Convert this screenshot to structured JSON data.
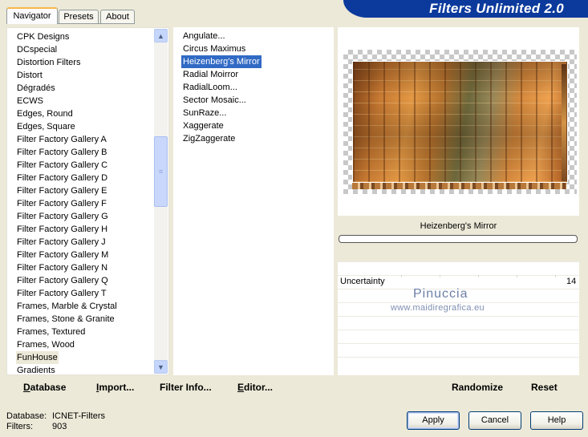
{
  "tabs": [
    {
      "label": "Navigator",
      "active": true
    },
    {
      "label": "Presets",
      "active": false
    },
    {
      "label": "About",
      "active": false
    }
  ],
  "banner": {
    "title": "Filters Unlimited 2.0",
    "color": "#0c3a9c"
  },
  "categories": [
    "CPK Designs",
    "DCspecial",
    "Distortion Filters",
    "Distort",
    "Dégradés",
    "ECWS",
    "Edges, Round",
    "Edges, Square",
    "Filter Factory Gallery A",
    "Filter Factory Gallery B",
    "Filter Factory Gallery C",
    "Filter Factory Gallery D",
    "Filter Factory Gallery E",
    "Filter Factory Gallery F",
    "Filter Factory Gallery G",
    "Filter Factory Gallery H",
    "Filter Factory Gallery J",
    "Filter Factory Gallery M",
    "Filter Factory Gallery N",
    "Filter Factory Gallery Q",
    "Filter Factory Gallery T",
    "Frames, Marble & Crystal",
    "Frames, Stone & Granite",
    "Frames, Textured",
    "Frames, Wood",
    "FunHouse",
    "Gradients"
  ],
  "selected_category": "FunHouse",
  "filters": [
    "Angulate...",
    "Circus Maximus",
    "Heizenberg's Mirror",
    "Radial Moirror",
    "RadialLoom...",
    "Sector Mosaic...",
    "SunRaze...",
    "Xaggerate",
    "ZigZaggerate"
  ],
  "selected_filter": "Heizenberg's Mirror",
  "selection_color": "#316ac5",
  "current_filter_name": "Heizenberg's Mirror",
  "parameters": [
    {
      "name": "Uncertainty",
      "value": "14"
    }
  ],
  "watermark": {
    "name": "Pinuccia",
    "url": "www.maidiregrafica.eu"
  },
  "toolbar_left": [
    {
      "label": "Database",
      "underline": "D",
      "rest": "atabase"
    },
    {
      "label": "Import...",
      "underline": "I",
      "rest": "mport..."
    },
    {
      "label": "Filter Info...",
      "underline": "",
      "rest": "Filter Info..."
    },
    {
      "label": "Editor...",
      "underline": "E",
      "rest": "ditor..."
    }
  ],
  "toolbar_right": [
    {
      "label": "Randomize"
    },
    {
      "label": "Reset"
    }
  ],
  "status": {
    "database_label": "Database:",
    "database_value": "ICNET-Filters",
    "filters_label": "Filters:",
    "filters_value": "903"
  },
  "buttons": {
    "apply": "Apply",
    "cancel": "Cancel",
    "help": "Help"
  }
}
